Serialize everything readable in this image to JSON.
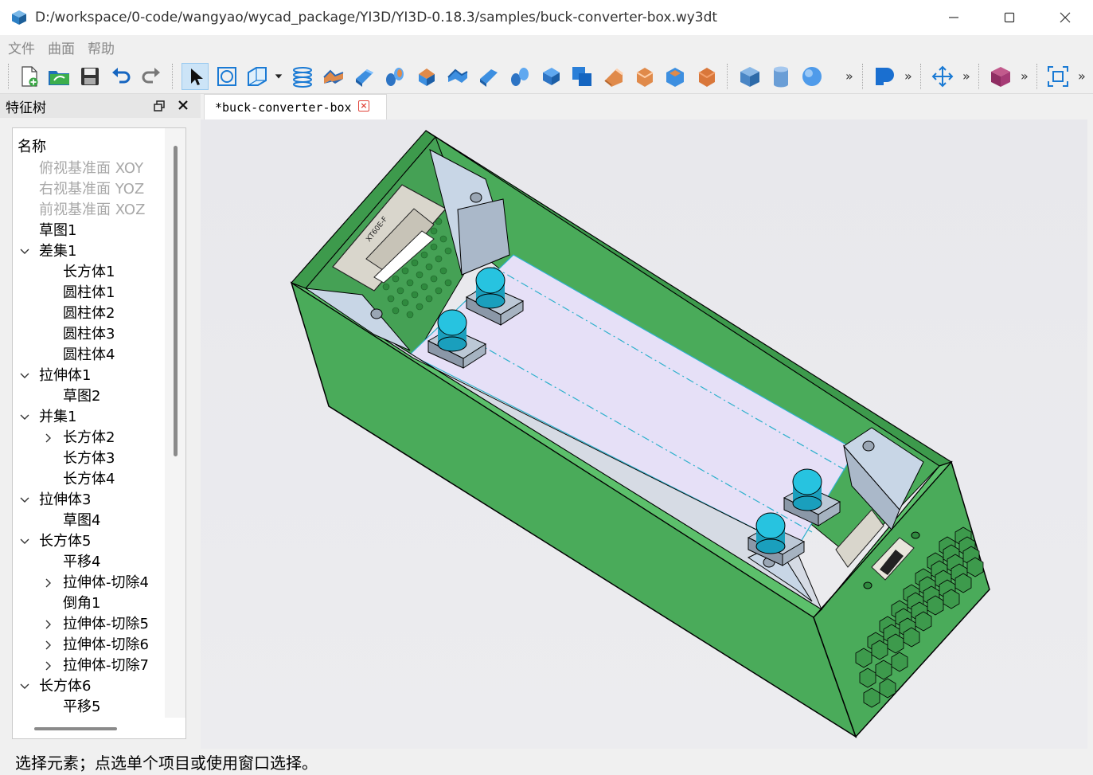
{
  "window": {
    "title": "D:/workspace/0-code/wangyao/wycad_package/YI3D/YI3D-0.18.3/samples/buck-converter-box.wy3dt"
  },
  "menu": [
    "文件",
    "曲面",
    "帮助"
  ],
  "toolbar": {
    "more_glyph": "»"
  },
  "dock": {
    "title": "特征树",
    "header": "名称",
    "items": [
      {
        "label": "俯视基准面 XOY",
        "level": 1,
        "disabled": true,
        "arrow": "none"
      },
      {
        "label": "右视基准面 YOZ",
        "level": 1,
        "disabled": true,
        "arrow": "none"
      },
      {
        "label": "前视基准面 XOZ",
        "level": 1,
        "disabled": true,
        "arrow": "none"
      },
      {
        "label": "草图1",
        "level": 1,
        "disabled": false,
        "arrow": "none"
      },
      {
        "label": "差集1",
        "level": 1,
        "disabled": false,
        "arrow": "expanded"
      },
      {
        "label": "长方体1",
        "level": 2,
        "disabled": false,
        "arrow": "none"
      },
      {
        "label": "圆柱体1",
        "level": 2,
        "disabled": false,
        "arrow": "none"
      },
      {
        "label": "圆柱体2",
        "level": 2,
        "disabled": false,
        "arrow": "none"
      },
      {
        "label": "圆柱体3",
        "level": 2,
        "disabled": false,
        "arrow": "none"
      },
      {
        "label": "圆柱体4",
        "level": 2,
        "disabled": false,
        "arrow": "none"
      },
      {
        "label": "拉伸体1",
        "level": 1,
        "disabled": false,
        "arrow": "expanded"
      },
      {
        "label": "草图2",
        "level": 2,
        "disabled": false,
        "arrow": "none"
      },
      {
        "label": "并集1",
        "level": 1,
        "disabled": false,
        "arrow": "expanded"
      },
      {
        "label": "长方体2",
        "level": 2,
        "disabled": false,
        "arrow": "collapsed"
      },
      {
        "label": "长方体3",
        "level": 2,
        "disabled": false,
        "arrow": "none"
      },
      {
        "label": "长方体4",
        "level": 2,
        "disabled": false,
        "arrow": "none"
      },
      {
        "label": "拉伸体3",
        "level": 1,
        "disabled": false,
        "arrow": "expanded"
      },
      {
        "label": "草图4",
        "level": 2,
        "disabled": false,
        "arrow": "none"
      },
      {
        "label": "长方体5",
        "level": 1,
        "disabled": false,
        "arrow": "expanded"
      },
      {
        "label": "平移4",
        "level": 2,
        "disabled": false,
        "arrow": "none"
      },
      {
        "label": "拉伸体-切除4",
        "level": 2,
        "disabled": false,
        "arrow": "collapsed"
      },
      {
        "label": "倒角1",
        "level": 2,
        "disabled": false,
        "arrow": "none"
      },
      {
        "label": "拉伸体-切除5",
        "level": 2,
        "disabled": false,
        "arrow": "collapsed"
      },
      {
        "label": "拉伸体-切除6",
        "level": 2,
        "disabled": false,
        "arrow": "collapsed"
      },
      {
        "label": "拉伸体-切除7",
        "level": 2,
        "disabled": false,
        "arrow": "collapsed"
      },
      {
        "label": "长方体6",
        "level": 1,
        "disabled": false,
        "arrow": "expanded"
      },
      {
        "label": "平移5",
        "level": 2,
        "disabled": false,
        "arrow": "none"
      }
    ]
  },
  "tab": {
    "label": "*buck-converter-box"
  },
  "model": {
    "label_on_connector": "XT60E-F",
    "colors": {
      "box_green": "#4aab5a",
      "box_green_dark": "#3d9a4c",
      "interior_floor": "#e6e0f7",
      "mount_blue": "#c8d6e6",
      "button_cyan": "#27c3e0",
      "edge": "#000000"
    }
  },
  "status": {
    "text": "选择元素；点选单个项目或使用窗口选择。"
  }
}
